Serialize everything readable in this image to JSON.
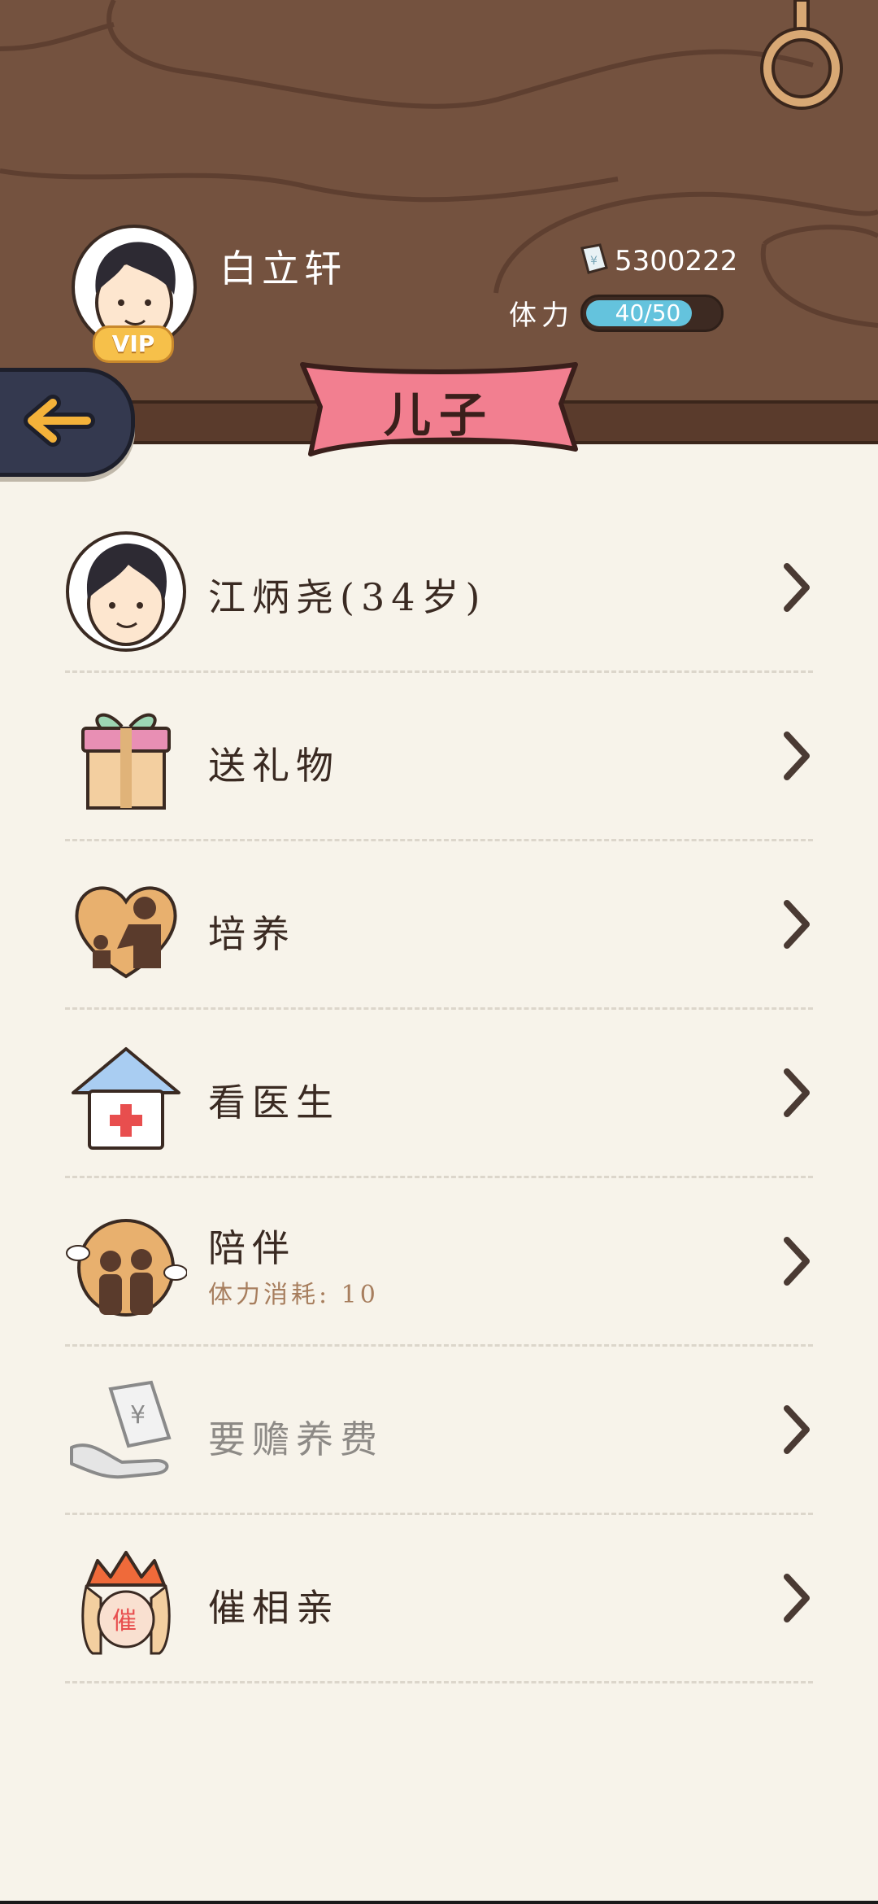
{
  "user": {
    "name": "白立轩",
    "vip_label": "VIP",
    "money": "5300222",
    "stamina_label": "体力",
    "stamina_text": "40/50",
    "stamina_fraction": 0.8
  },
  "page": {
    "title": "儿子"
  },
  "menu": [
    {
      "key": "son",
      "label": "江炳尧(34岁)",
      "icon": "son-avatar-icon",
      "enabled": true
    },
    {
      "key": "gift",
      "label": "送礼物",
      "icon": "gift-icon",
      "enabled": true
    },
    {
      "key": "train",
      "label": "培养",
      "icon": "parent-child-heart-icon",
      "enabled": true
    },
    {
      "key": "doctor",
      "label": "看医生",
      "icon": "hospital-icon",
      "enabled": true
    },
    {
      "key": "accompany",
      "label": "陪伴",
      "sub": "体力消耗: 10",
      "icon": "companionship-icon",
      "enabled": true
    },
    {
      "key": "alimony",
      "label": "要赡养费",
      "icon": "money-hand-icon",
      "enabled": false
    },
    {
      "key": "matchmaking",
      "label": "催相亲",
      "icon": "urge-marriage-icon",
      "enabled": true
    }
  ],
  "colors": {
    "wood": "#74523f",
    "ribbon": "#f08090",
    "stamina": "#64c3dd",
    "back_button": "#34394f"
  }
}
